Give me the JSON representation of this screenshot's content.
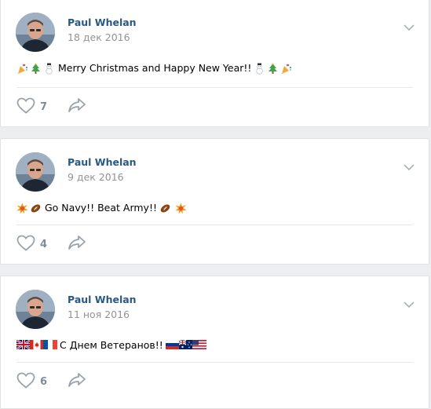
{
  "posts": [
    {
      "author": "Paul Whelan",
      "date": "18 дек 2016",
      "text": "Merry Christmas and Happy New Year!!",
      "emoji_before": [
        "party-popper",
        "christmas-tree",
        "snowman"
      ],
      "emoji_after": [
        "snowman",
        "christmas-tree",
        "party-popper"
      ],
      "likes": "7"
    },
    {
      "author": "Paul Whelan",
      "date": "9 дек 2016",
      "text": "Go Navy!! Beat Army!!",
      "emoji_before": [
        "collision",
        "american-football"
      ],
      "emoji_after": [
        "american-football",
        "collision"
      ],
      "likes": "4"
    },
    {
      "author": "Paul Whelan",
      "date": "11 ноя 2016",
      "text": "С Днем Ветеранов!!",
      "emoji_before": [
        "flag-gb",
        "flag-ca",
        "flag-fr"
      ],
      "emoji_after": [
        "flag-ru",
        "flag-au",
        "flag-us"
      ],
      "likes": "6"
    }
  ],
  "colors": {
    "author_link": "#2a5885",
    "meta_grey": "#939393",
    "action_grey": "#828a99",
    "page_bg": "#edeef0"
  }
}
